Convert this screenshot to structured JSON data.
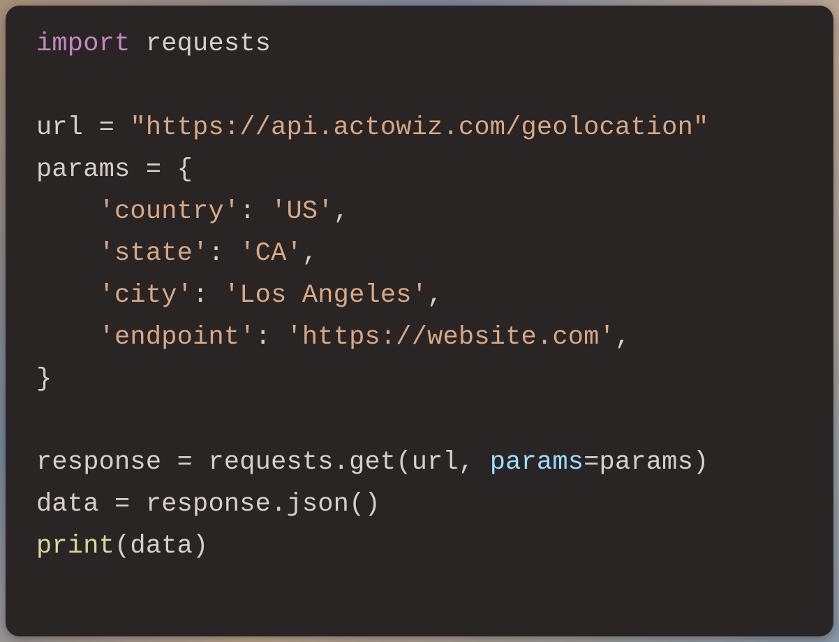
{
  "code": {
    "tokens": [
      {
        "cls": "tok-keyword",
        "text": "import"
      },
      {
        "cls": "tok-ident",
        "text": " requests"
      },
      {
        "cls": "",
        "text": "\n"
      },
      {
        "cls": "",
        "text": "\n"
      },
      {
        "cls": "tok-ident",
        "text": "url "
      },
      {
        "cls": "tok-op",
        "text": "="
      },
      {
        "cls": "tok-ident",
        "text": " "
      },
      {
        "cls": "tok-string",
        "text": "\"https://api.actowiz.com/geolocation\""
      },
      {
        "cls": "",
        "text": "\n"
      },
      {
        "cls": "tok-ident",
        "text": "params "
      },
      {
        "cls": "tok-op",
        "text": "="
      },
      {
        "cls": "tok-ident",
        "text": " "
      },
      {
        "cls": "tok-punct",
        "text": "{"
      },
      {
        "cls": "",
        "text": "\n"
      },
      {
        "cls": "tok-ident",
        "text": "    "
      },
      {
        "cls": "tok-string",
        "text": "'country'"
      },
      {
        "cls": "tok-punct",
        "text": ": "
      },
      {
        "cls": "tok-string",
        "text": "'US'"
      },
      {
        "cls": "tok-punct",
        "text": ","
      },
      {
        "cls": "",
        "text": "\n"
      },
      {
        "cls": "tok-ident",
        "text": "    "
      },
      {
        "cls": "tok-string",
        "text": "'state'"
      },
      {
        "cls": "tok-punct",
        "text": ": "
      },
      {
        "cls": "tok-string",
        "text": "'CA'"
      },
      {
        "cls": "tok-punct",
        "text": ","
      },
      {
        "cls": "",
        "text": "\n"
      },
      {
        "cls": "tok-ident",
        "text": "    "
      },
      {
        "cls": "tok-string",
        "text": "'city'"
      },
      {
        "cls": "tok-punct",
        "text": ": "
      },
      {
        "cls": "tok-string",
        "text": "'Los Angeles'"
      },
      {
        "cls": "tok-punct",
        "text": ","
      },
      {
        "cls": "",
        "text": "\n"
      },
      {
        "cls": "tok-ident",
        "text": "    "
      },
      {
        "cls": "tok-string",
        "text": "'endpoint'"
      },
      {
        "cls": "tok-punct",
        "text": ": "
      },
      {
        "cls": "tok-string",
        "text": "'https://website.com'"
      },
      {
        "cls": "tok-punct",
        "text": ","
      },
      {
        "cls": "",
        "text": "\n"
      },
      {
        "cls": "tok-punct",
        "text": "}"
      },
      {
        "cls": "",
        "text": "\n"
      },
      {
        "cls": "",
        "text": "\n"
      },
      {
        "cls": "tok-ident",
        "text": "response "
      },
      {
        "cls": "tok-op",
        "text": "="
      },
      {
        "cls": "tok-ident",
        "text": " requests.get(url, "
      },
      {
        "cls": "tok-kwarg",
        "text": "params"
      },
      {
        "cls": "tok-op",
        "text": "="
      },
      {
        "cls": "tok-ident",
        "text": "params)"
      },
      {
        "cls": "",
        "text": "\n"
      },
      {
        "cls": "tok-ident",
        "text": "data "
      },
      {
        "cls": "tok-op",
        "text": "="
      },
      {
        "cls": "tok-ident",
        "text": " response.json()"
      },
      {
        "cls": "",
        "text": "\n"
      },
      {
        "cls": "tok-func",
        "text": "print"
      },
      {
        "cls": "tok-ident",
        "text": "(data)"
      }
    ]
  }
}
